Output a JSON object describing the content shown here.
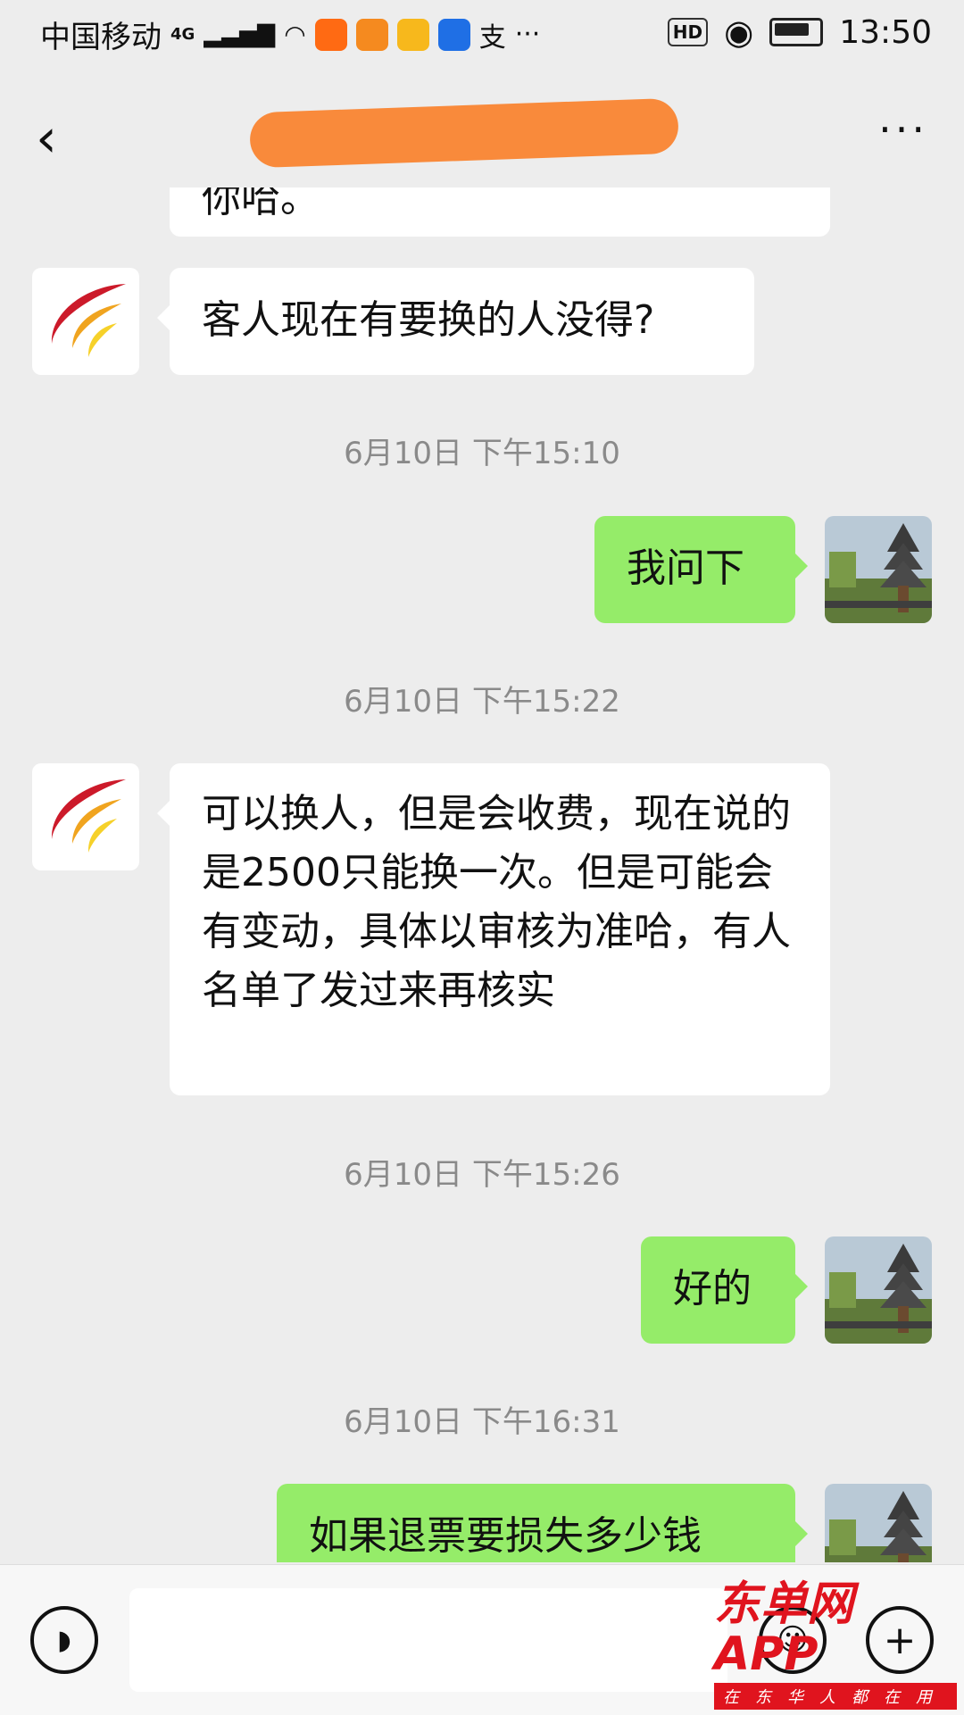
{
  "status_bar": {
    "carrier": "中国移动",
    "network": "4G",
    "app_icons": [
      "taobao-icon",
      "video-icon",
      "coffee-icon",
      "bulb-icon",
      "alipay-icon"
    ],
    "hd_label": "HD",
    "time": "13:50"
  },
  "nav": {
    "title_redacted": true
  },
  "messages": {
    "partial_top_text": "你哈。",
    "m1_text": "客人现在有要换的人没得?",
    "t1": "6月10日 下午15:10",
    "m2_text": "我问下",
    "t2": "6月10日 下午15:22",
    "m3_text": "可以换人，但是会收费，现在说的是2500只能换一次。但是可能会有变动，具体以审核为准哈，有人名单了发过来再核实",
    "t3": "6月10日 下午15:26",
    "m4_text": "好的",
    "t4": "6月10日 下午16:31",
    "m5_text": "如果退票要损失多少钱"
  },
  "watermark": {
    "brand": "东单网APP",
    "slogan": "在东华人都在用"
  },
  "colors": {
    "background": "#ededed",
    "my_bubble": "#95ec69",
    "their_bubble": "#ffffff",
    "redaction": "#f98a3b",
    "watermark": "#e0141e"
  }
}
